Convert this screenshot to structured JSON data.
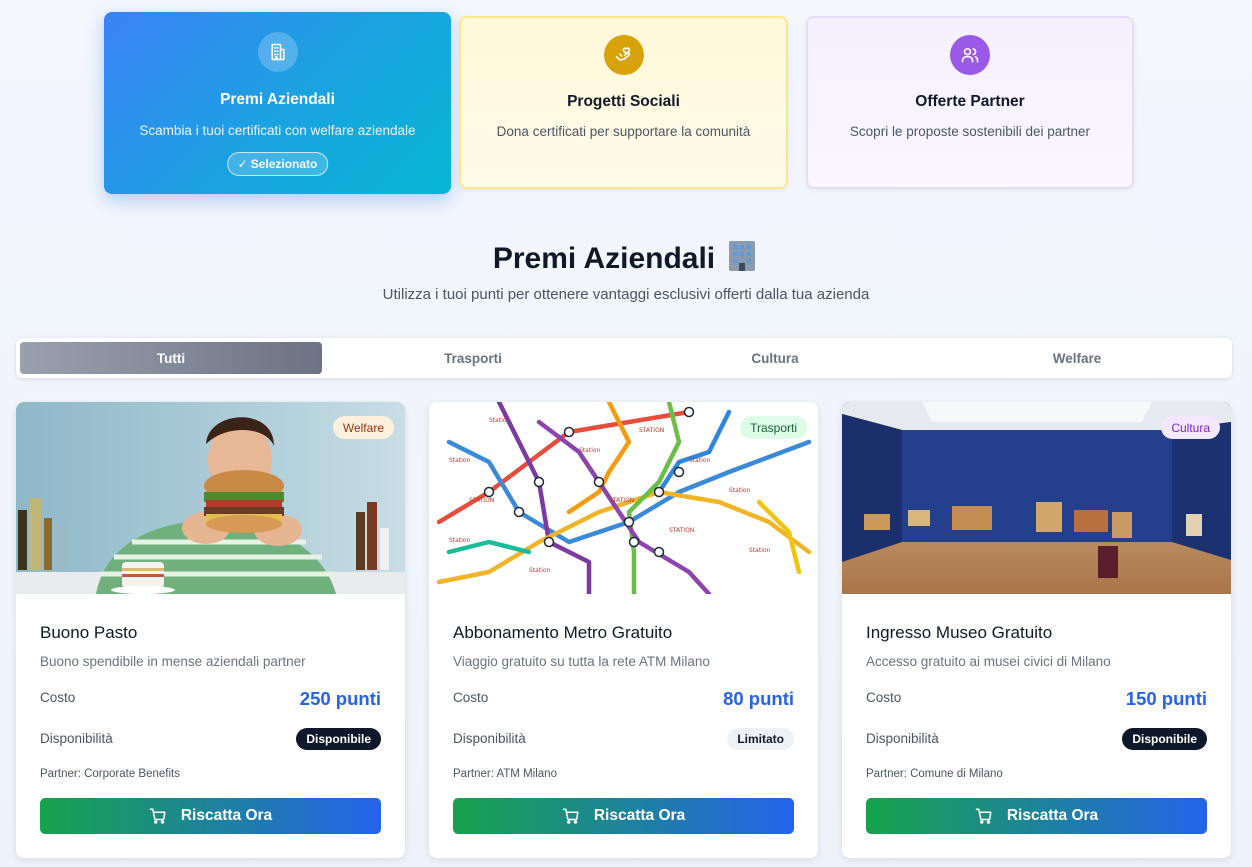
{
  "categories": [
    {
      "title": "Premi Aziendali",
      "description": "Scambia i tuoi certificati con welfare aziendale",
      "selected_label": "Selezionato",
      "icon": "building-icon"
    },
    {
      "title": "Progetti Sociali",
      "description": "Dona certificati per supportare la comunità",
      "icon": "heart-hand-icon"
    },
    {
      "title": "Offerte Partner",
      "description": "Scopri le proposte sostenibili dei partner",
      "icon": "users-icon"
    }
  ],
  "section": {
    "title": "Premi Aziendali",
    "emoji": "🏢",
    "subtitle": "Utilizza i tuoi punti per ottenere vantaggi esclusivi offerti dalla tua azienda"
  },
  "tabs": [
    "Tutti",
    "Trasporti",
    "Cultura",
    "Welfare"
  ],
  "active_tab": "Tutti",
  "labels": {
    "cost": "Costo",
    "availability": "Disponibilità",
    "redeem": "Riscatta Ora"
  },
  "rewards": [
    {
      "category": "Welfare",
      "title": "Buono Pasto",
      "description": "Buono spendibile in mense aziendali partner",
      "cost": "250 punti",
      "availability": "Disponibile",
      "partner": "Partner: Corporate Benefits",
      "image": "person eating burger"
    },
    {
      "category": "Trasporti",
      "title": "Abbonamento Metro Gratuito",
      "description": "Viaggio gratuito su tutta la rete ATM Milano",
      "cost": "80 punti",
      "availability": "Limitato",
      "partner": "Partner: ATM Milano",
      "image": "metro map"
    },
    {
      "category": "Cultura",
      "title": "Ingresso Museo Gratuito",
      "description": "Accesso gratuito ai musei civici di Milano",
      "cost": "150 punti",
      "availability": "Disponibile",
      "partner": "Partner: Comune di Milano",
      "image": "museum gallery"
    }
  ],
  "colors": {
    "accent_blue": "#2563eb",
    "cta_green": "#16a34a",
    "selected_card": "#3b82f6",
    "social_card": "#fff8d9",
    "partner_card": "#f5f0ff"
  }
}
